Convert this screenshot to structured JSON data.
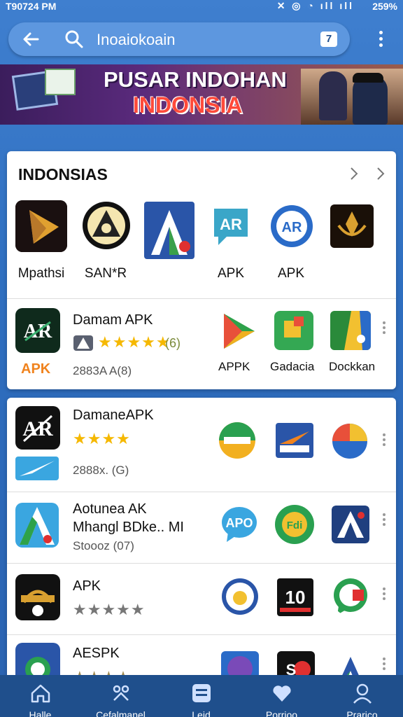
{
  "status_bar": {
    "time": "T90724 PM",
    "battery": "259%"
  },
  "search": {
    "query": "Inoaiokoain",
    "tab_count": "7"
  },
  "banner": {
    "line1": "PUSAR INDOHAN",
    "line2": "INDONSIA"
  },
  "section1": {
    "title": "INDONSIAS",
    "top_icons": [
      {
        "label": "Mpathsi"
      },
      {
        "label": "SAN*R"
      },
      {
        "label": ""
      },
      {
        "label": "APK"
      },
      {
        "label": "APK"
      },
      {
        "label": ""
      }
    ],
    "featured": {
      "name": "Damam APK",
      "stars": "★★★★★",
      "rating": "(6)",
      "apk_tag": "APK",
      "downloads": "2883A A(8)",
      "mini_icons": [
        {
          "label": "APPK"
        },
        {
          "label": "Gadacia"
        },
        {
          "label": "Dockkan"
        }
      ]
    }
  },
  "list": [
    {
      "name": "DamaneAPK",
      "line2": "",
      "stars": "★★★★",
      "sub": "2888x. (G)"
    },
    {
      "name": "Aotunea AK",
      "line2": "Mhangl BDke..  MI",
      "stars": "",
      "sub": "Stoooz (07)"
    },
    {
      "name": "APK",
      "line2": "",
      "stars": "★★★★★",
      "sub": ""
    },
    {
      "name": "AESPK",
      "line2": "",
      "stars": "★★★★",
      "sub": ""
    }
  ],
  "bottom_nav": [
    {
      "label": "Halle",
      "icon": "home-icon"
    },
    {
      "label": "Cefalmanel",
      "icon": "tools-icon"
    },
    {
      "label": "Leid",
      "icon": "list-icon"
    },
    {
      "label": "Porrioo",
      "icon": "heart-icon"
    },
    {
      "label": "Prarico",
      "icon": "profile-icon"
    }
  ],
  "colors": {
    "accent": "#2f6fc0",
    "nav": "#1f4f8c",
    "star": "#f5b800",
    "apk_orange": "#f0831e"
  }
}
